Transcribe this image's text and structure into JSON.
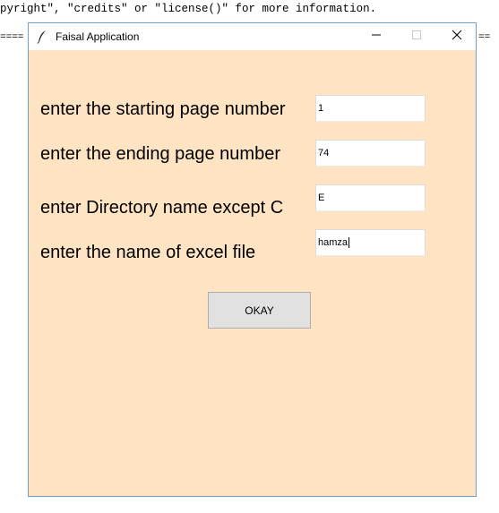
{
  "console": {
    "top_line": "pyright\", \"credits\" or \"license()\" for more information.",
    "rule_left": "====",
    "rule_right": "=="
  },
  "window": {
    "title": "Faisal Application",
    "icon": "feather-icon",
    "controls": {
      "minimize_icon": "minimize-icon",
      "maximize_icon": "maximize-icon",
      "close_icon": "close-icon"
    },
    "background_color": "#ffe4c4"
  },
  "form": {
    "fields": [
      {
        "label": "enter the starting page number",
        "value": "1"
      },
      {
        "label": "enter the ending page number",
        "value": "74"
      },
      {
        "label": "enter Directory name except C",
        "value": "E"
      },
      {
        "label": "enter the name of excel file",
        "value": "hamza"
      }
    ],
    "okay_label": "OKAY"
  }
}
